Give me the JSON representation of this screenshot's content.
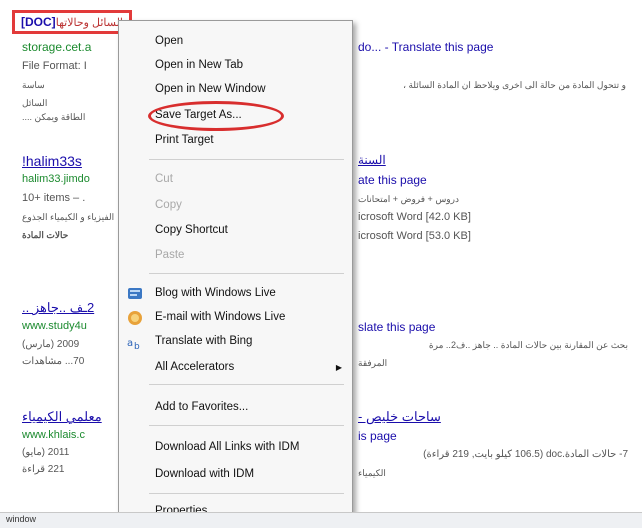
{
  "top_highlight": {
    "doc_label": "[DOC]",
    "arabic_label": "السائل وحالاتها"
  },
  "results": [
    {
      "url": "storage.cet.a",
      "title_suffix": "do... - Translate this page",
      "file_format": "File Format: I",
      "snippet_rtl_1": "و تتحول المادة من حالة الى اخرى ويلاحظ ان المادة السائلة ،",
      "snippet_rtl_2": "الطاقة ويمكن ....",
      "snippet_left_2": "السائل",
      "snippet_left_3": "ساسة"
    },
    {
      "title": "!halim33s",
      "title_right": "السنة",
      "url": "halim33.jimdo",
      "translate": "ate this page",
      "items": "10+ items – .",
      "snippet_rtl_1": "دروس + فروض + امتحانات",
      "snippet_left_1": "الفيزياء و الكيمياء الجذوع",
      "snippet_left_2": "حالات المادة",
      "word_1": "icrosoft Word [42.0 KB]",
      "word_2": "icrosoft Word [53.0 KB]"
    },
    {
      "title": "2ـف ..جاهز ..",
      "url": "www.study4u",
      "translate": "slate this page",
      "date": "2009 (مارس)",
      "views": "70... مشاهدات",
      "snippet_rtl_1": "بحث عن المقارنة بين حالات المادة .. جاهز ..ف2.. مرة",
      "snippet_rtl_2": "المرفقة"
    },
    {
      "title": "معلمي الكيمياء",
      "title_right": "ساحات خليص -",
      "url": "www.khlais.c",
      "translate": "is page",
      "date": "2011 (مايو)",
      "views": "221 قراءة",
      "snippet_rtl_1": "7- حالات المادة.doc (106.5 كيلو بايت, 219 قراءة)",
      "snippet_rtl_2": "الكيمياء"
    }
  ],
  "context_menu": {
    "items": [
      {
        "label": "Open",
        "disabled": false
      },
      {
        "label": "Open in New Tab",
        "disabled": false
      },
      {
        "label": "Open in New Window",
        "disabled": false
      },
      {
        "label": "Save Target As...",
        "disabled": false
      },
      {
        "label": "Print Target",
        "disabled": false
      },
      {
        "label": "Cut",
        "disabled": true
      },
      {
        "label": "Copy",
        "disabled": true
      },
      {
        "label": "Copy Shortcut",
        "disabled": false
      },
      {
        "label": "Paste",
        "disabled": true
      },
      {
        "label": "Blog with Windows Live",
        "disabled": false,
        "icon": "windows-live-icon"
      },
      {
        "label": "E-mail with Windows Live",
        "disabled": false,
        "icon": "email-icon"
      },
      {
        "label": "Translate with Bing",
        "disabled": false,
        "icon": "translate-icon"
      },
      {
        "label": "All Accelerators",
        "disabled": false,
        "submenu": true
      },
      {
        "label": "Add to Favorites...",
        "disabled": false
      },
      {
        "label": "Download All Links with IDM",
        "disabled": false
      },
      {
        "label": "Download with IDM",
        "disabled": false
      },
      {
        "label": "Properties",
        "disabled": false
      }
    ]
  },
  "status_bar": {
    "text": "window"
  },
  "colors": {
    "link": "#1a0dab",
    "url": "#1b8a2e",
    "highlight": "#e23a3a"
  }
}
